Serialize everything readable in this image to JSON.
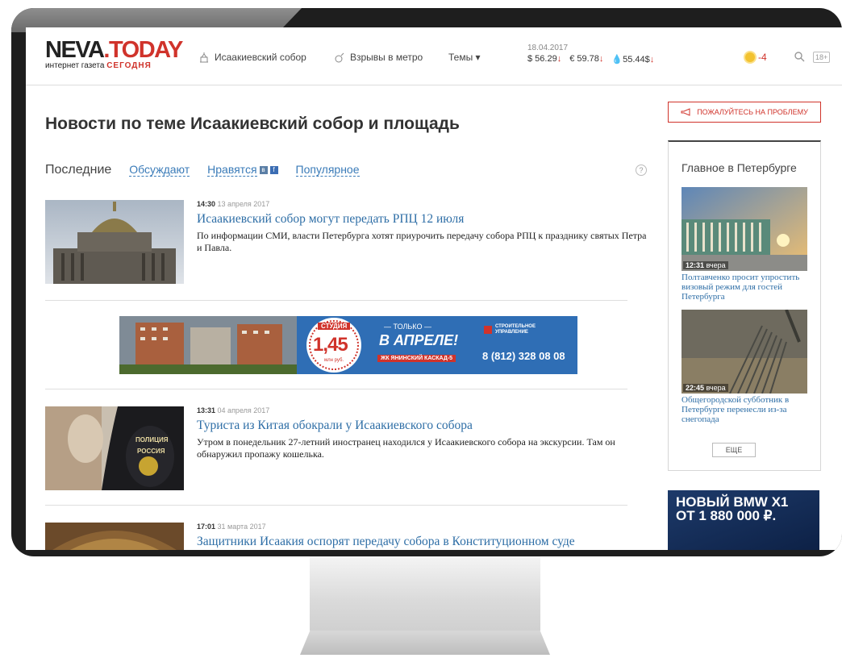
{
  "header": {
    "logo_main": "NEVA",
    "logo_today": ".TODAY",
    "logo_sub": "интернет газета",
    "logo_sub_red": "СЕГОДНЯ",
    "nav": [
      {
        "label": "Исаакиевский собор",
        "icon": "cathedral-icon"
      },
      {
        "label": "Взрывы в метро",
        "icon": "bomb-icon"
      },
      {
        "label": "Темы ▾",
        "icon": null
      }
    ],
    "rates_date": "18.04.2017",
    "rates": [
      {
        "label": "$ 56.29",
        "trend": "↓"
      },
      {
        "label": "€ 59.78",
        "trend": "↓"
      },
      {
        "label": "💧55.44$",
        "trend": "↓"
      }
    ],
    "weather": "-4",
    "age_rating": "18+"
  },
  "main": {
    "title": "Новости по теме Исаакиевский собор и площадь",
    "tabs": {
      "active": "Последние",
      "items": [
        "Обсуждают",
        "Нравятся",
        "Популярное"
      ]
    },
    "help": "?",
    "articles": [
      {
        "time": "14:30",
        "date": "13 апреля 2017",
        "title": "Исаакиевский собор могут передать РПЦ 12 июля",
        "lead": "По информации СМИ, власти Петербурга хотят приурочить передачу собора РПЦ к празднику святых Петра и Павла."
      },
      {
        "time": "13:31",
        "date": "04 апреля 2017",
        "title": "Туриста из Китая обокрали у Исаакиевского собора",
        "lead": "Утром в понедельник 27-летний иностранец находился у Исаакиевского собора на экскурсии. Там он обнаружил пропажу кошелька."
      },
      {
        "time": "17:01",
        "date": "31 марта 2017",
        "title": "Защитники Исаакия оспорят передачу собора в Конституционном суде",
        "lead": ""
      }
    ],
    "banner": {
      "studio": "СТУДИЯ",
      "price": "1,45",
      "price_unit": "млн руб.",
      "only": "— ТОЛЬКО —",
      "april": "В АПРЕЛЕ!",
      "complex": "ЖК ЯНИНСКИЙ КАСКАД-5",
      "company": "СТРОИТЕЛЬНОЕ УПРАВЛЕНИЕ",
      "phone": "8 (812) 328 08 08"
    }
  },
  "sidebar": {
    "complain": "ПОЖАЛУЙТЕСЬ НА ПРОБЛЕМУ",
    "title": "Главное в Петербурге",
    "items": [
      {
        "time": "12:31",
        "when": "вчера",
        "text": "Полтавченко просит упростить визовый режим для гостей Петербурга"
      },
      {
        "time": "22:45",
        "when": "вчера",
        "text": "Общегородской субботник в Петербурге перенесли из-за снегопада"
      }
    ],
    "more": "ЕЩЕ",
    "ad_line1": "НОВЫЙ BMW X1",
    "ad_line2": "ОТ 1 880 000 ₽."
  }
}
